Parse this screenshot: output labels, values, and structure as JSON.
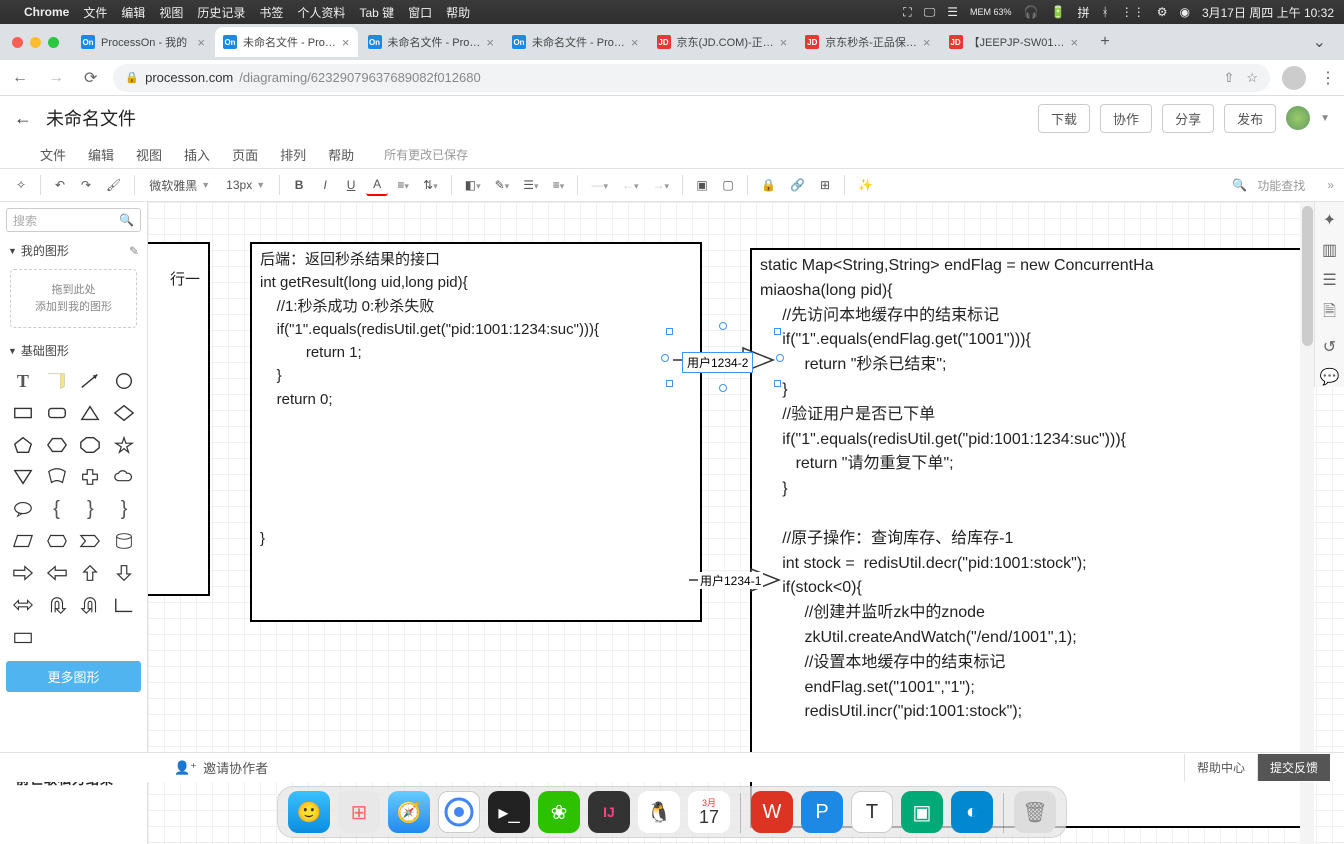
{
  "mac": {
    "app": "Chrome",
    "menus": [
      "文件",
      "编辑",
      "视图",
      "历史记录",
      "书签",
      "个人资料",
      "Tab 键",
      "窗口",
      "帮助"
    ],
    "mem": "MEM 63%",
    "ime": "拼",
    "date": "3月17日 周四 上午 10:32"
  },
  "tabs": [
    {
      "fav": "On",
      "title": "ProcessOn - 我的",
      "cls": "",
      "color": ""
    },
    {
      "fav": "On",
      "title": "未命名文件 - Pro…",
      "cls": "active",
      "color": ""
    },
    {
      "fav": "On",
      "title": "未命名文件 - Pro…",
      "cls": "",
      "color": ""
    },
    {
      "fav": "On",
      "title": "未命名文件 - Pro…",
      "cls": "",
      "color": ""
    },
    {
      "fav": "JD",
      "title": "京东(JD.COM)-正…",
      "cls": "",
      "color": "jd"
    },
    {
      "fav": "JD",
      "title": "京东秒杀-正品保…",
      "cls": "",
      "color": "jd"
    },
    {
      "fav": "JD",
      "title": "【JEEPJP-SW01…",
      "cls": "",
      "color": "jd"
    }
  ],
  "url": {
    "host": "processon.com",
    "path": "/diagraming/62329079637689082f012680"
  },
  "po": {
    "title": "未命名文件",
    "buttons": [
      "下载",
      "协作",
      "分享",
      "发布"
    ],
    "menus": [
      "文件",
      "编辑",
      "视图",
      "插入",
      "页面",
      "排列",
      "帮助"
    ],
    "save": "所有更改已保存",
    "font": "微软雅黑",
    "size": "13px",
    "search_placeholder": "搜索",
    "search_hint": "功能查找",
    "myshapes": "我的图形",
    "dropzone1": "拖到此处",
    "dropzone2": "添加到我的图形",
    "basicshapes": "基础图形",
    "more": "更多图形"
  },
  "canvas": {
    "partial": "行一",
    "leftcode": "后端：返回秒杀结果的接口\nint getResult(long uid,long pid){\n    //1:秒杀成功 0:秒杀失败\n    if(\"1\".equals(redisUtil.get(\"pid:1001:1234:suc\"))){\n           return 1;\n    }\n    return 0;\n\n\n\n\n\n}\n",
    "rightcode": "static Map<String,String> endFlag = new ConcurrentHa\nmiaosha(long pid){\n     //先访问本地缓存中的结束标记\n     if(\"1\".equals(endFlag.get(\"1001\"))){\n          return \"秒杀已结束\";\n     }\n     //验证用户是否已下单\n     if(\"1\".equals(redisUtil.get(\"pid:1001:1234:suc\"))){\n        return \"请勿重复下单\";\n     }\n\n     //原子操作：查询库存、给库存-1\n     int stock =  redisUtil.decr(\"pid:1001:stock\");\n     if(stock<0){\n          //创建并监听zk中的znode\n          zkUtil.createAndWatch(\"/end/1001\",1);\n          //设置本地缓存中的结束标记\n          endFlag.set(\"1001\",\"1\");\n          redisUtil.incr(\"pid:1001:stock\");",
    "label1": "用户1234-2",
    "label2": "用户1234-1",
    "overflow": "前世取私力结果"
  },
  "bottom": {
    "collab": "邀请协作者",
    "help": "帮助中心",
    "feedback": "提交反馈"
  },
  "dock": {
    "cal_month": "3月",
    "cal_day": "17"
  }
}
